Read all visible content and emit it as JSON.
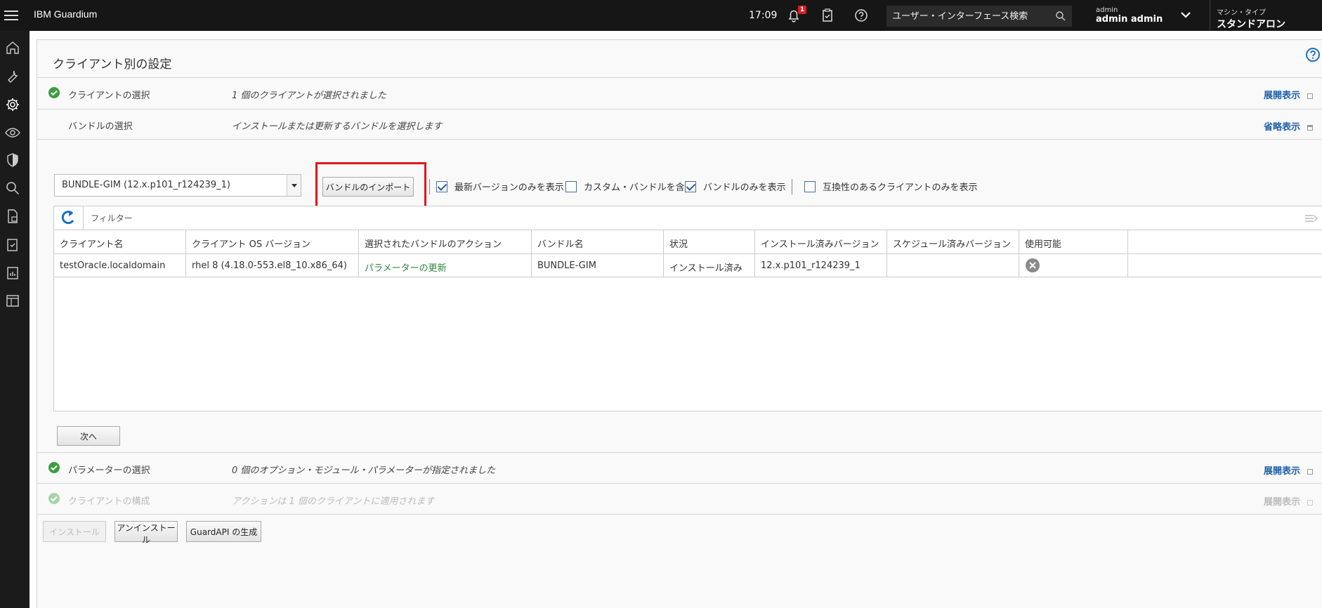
{
  "topbar": {
    "brand": "IBM Guardium",
    "time": "17:09",
    "notification_count": "1",
    "search_placeholder": "ユーザー・インターフェース検索",
    "user_role": "admin",
    "user_name": "admin admin",
    "machine_label": "マシン・タイプ",
    "machine_type": "スタンドアロン"
  },
  "page": {
    "title": "クライアント別の設定"
  },
  "steps": [
    {
      "label": "クライアントの選択",
      "desc": "1 個のクライアントが選択されました",
      "toggle": "展開表示"
    },
    {
      "label": "バンドルの選択",
      "desc": "インストールまたは更新するバンドルを選択します",
      "toggle": "省略表示"
    },
    {
      "label": "パラメーターの選択",
      "desc": "0 個のオプション・モジュール・パラメーターが指定されました",
      "toggle": "展開表示"
    },
    {
      "label": "クライアントの構成",
      "desc": "アクションは 1 個のクライアントに適用されます",
      "toggle": "展開表示"
    }
  ],
  "bundle": {
    "selected": "BUNDLE-GIM (12.x.p101_r124239_1)",
    "import_label": "バンドルのインポート",
    "options": [
      {
        "label": "最新バージョンのみを表示",
        "checked": true
      },
      {
        "label": "カスタム・バンドルを含む",
        "checked": false
      },
      {
        "label": "バンドルのみを表示",
        "checked": true
      },
      {
        "label": "互換性のあるクライアントのみを表示",
        "checked": false
      }
    ]
  },
  "grid": {
    "filter_placeholder": "フィルター",
    "columns": [
      "クライアント名",
      "クライアント OS バージョン",
      "選択されたバンドルのアクション",
      "バンドル名",
      "状況",
      "インストール済みバージョン",
      "スケジュール済みバージョン",
      "使用可能"
    ],
    "rows": [
      [
        "testOracle.localdomain",
        "rhel 8 (4.18.0-553.el8_10.x86_64)",
        "パラメーターの更新",
        "BUNDLE-GIM",
        "インストール済み",
        "12.x.p101_r124239_1",
        "",
        ""
      ]
    ]
  },
  "buttons": {
    "next": "次へ",
    "install": "インストール",
    "uninstall": "アンインストール",
    "guardapi": "GuardAPI の生成"
  }
}
